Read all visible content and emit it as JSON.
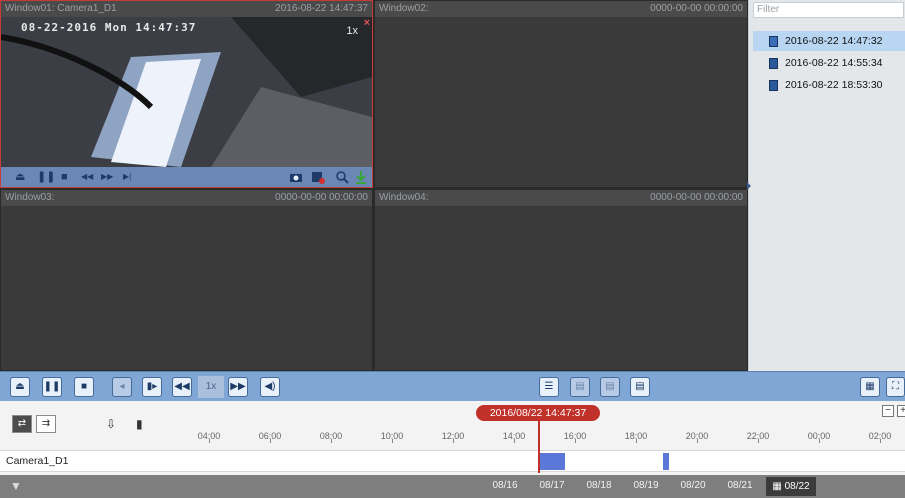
{
  "windows": [
    {
      "name": "Window01: Camera1_D1",
      "timestamp": "2016-08-22 14:47:37"
    },
    {
      "name": "Window02:",
      "timestamp": "0000-00-00 00:00:00"
    },
    {
      "name": "Window03:",
      "timestamp": "0000-00-00 00:00:00"
    },
    {
      "name": "Window04:",
      "timestamp": "0000-00-00 00:00:00"
    }
  ],
  "video": {
    "osd": "08-22-2016 Mon 14:47:37",
    "speed": "1x",
    "close": "×"
  },
  "pane_controls": {
    "slow": "⏏",
    "pause": "❚❚",
    "stop": "■",
    "rew": "◀◀",
    "fwd": "▶▶",
    "frame": "▶|"
  },
  "side": {
    "filter_placeholder": "Filter",
    "files": [
      {
        "label": "2016-08-22 14:47:32",
        "selected": true
      },
      {
        "label": "2016-08-22 14:55:34",
        "selected": false
      },
      {
        "label": "2016-08-22 18:53:30",
        "selected": false
      }
    ]
  },
  "toolbar": {
    "speed": "1x"
  },
  "timeline": {
    "cursor": "2016/08/22 14:47:37",
    "ticks": [
      "04:00",
      "06:00",
      "08:00",
      "10:00",
      "12:00",
      "14:00",
      "16:00",
      "18:00",
      "20:00",
      "22:00",
      "00:00",
      "02:00"
    ],
    "camera": "Camera1_D1",
    "recordings": [
      {
        "start": "14:47",
        "end": "15:40"
      },
      {
        "start": "18:53",
        "end": "19:05"
      }
    ]
  },
  "dates": [
    "08/16",
    "08/17",
    "08/18",
    "08/19",
    "08/20",
    "08/21"
  ],
  "selected_date": "08/22"
}
